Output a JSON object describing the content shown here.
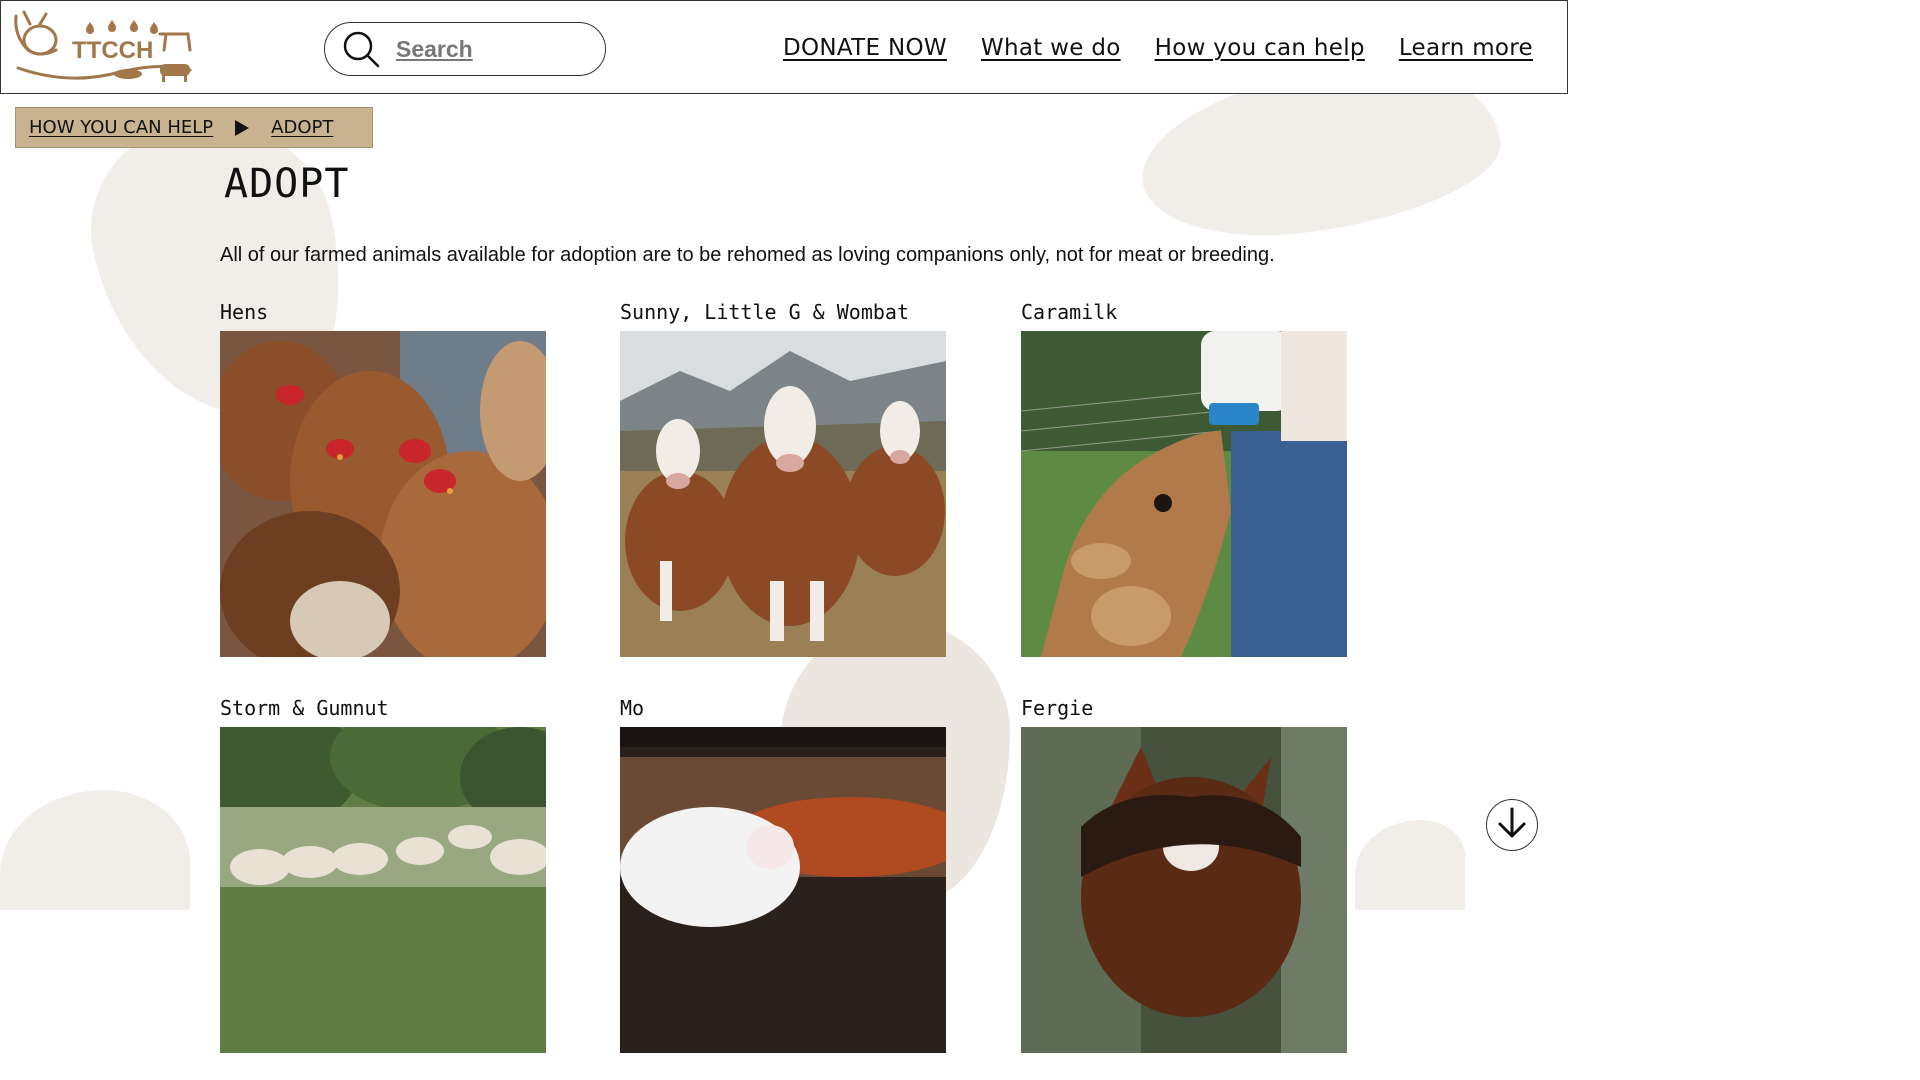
{
  "header": {
    "logo_text": "TTCCH",
    "search": {
      "placeholder": "Search",
      "icon": "search-icon"
    },
    "nav": [
      {
        "label": "DONATE NOW"
      },
      {
        "label": "What we do"
      },
      {
        "label": "How you can help"
      },
      {
        "label": "Learn more"
      }
    ]
  },
  "breadcrumb": {
    "items": [
      "HOW YOU CAN HELP",
      "ADOPT"
    ],
    "separator_icon": "triangle-right-icon"
  },
  "page": {
    "title": "ADOPT",
    "intro": "All of our farmed animals available for adoption are to be rehomed as loving companions only, not for meat or breeding."
  },
  "animals": [
    {
      "name": "Hens"
    },
    {
      "name": "Sunny, Little G & Wombat"
    },
    {
      "name": "Caramilk"
    },
    {
      "name": "Storm & Gumnut"
    },
    {
      "name": "Mo"
    },
    {
      "name": "Fergie"
    }
  ],
  "scroll_button": {
    "icon": "arrow-down-icon"
  },
  "colors": {
    "brand": "#a0784a",
    "breadcrumb_bg": "#c9b290",
    "blob": "#f1eeea"
  }
}
